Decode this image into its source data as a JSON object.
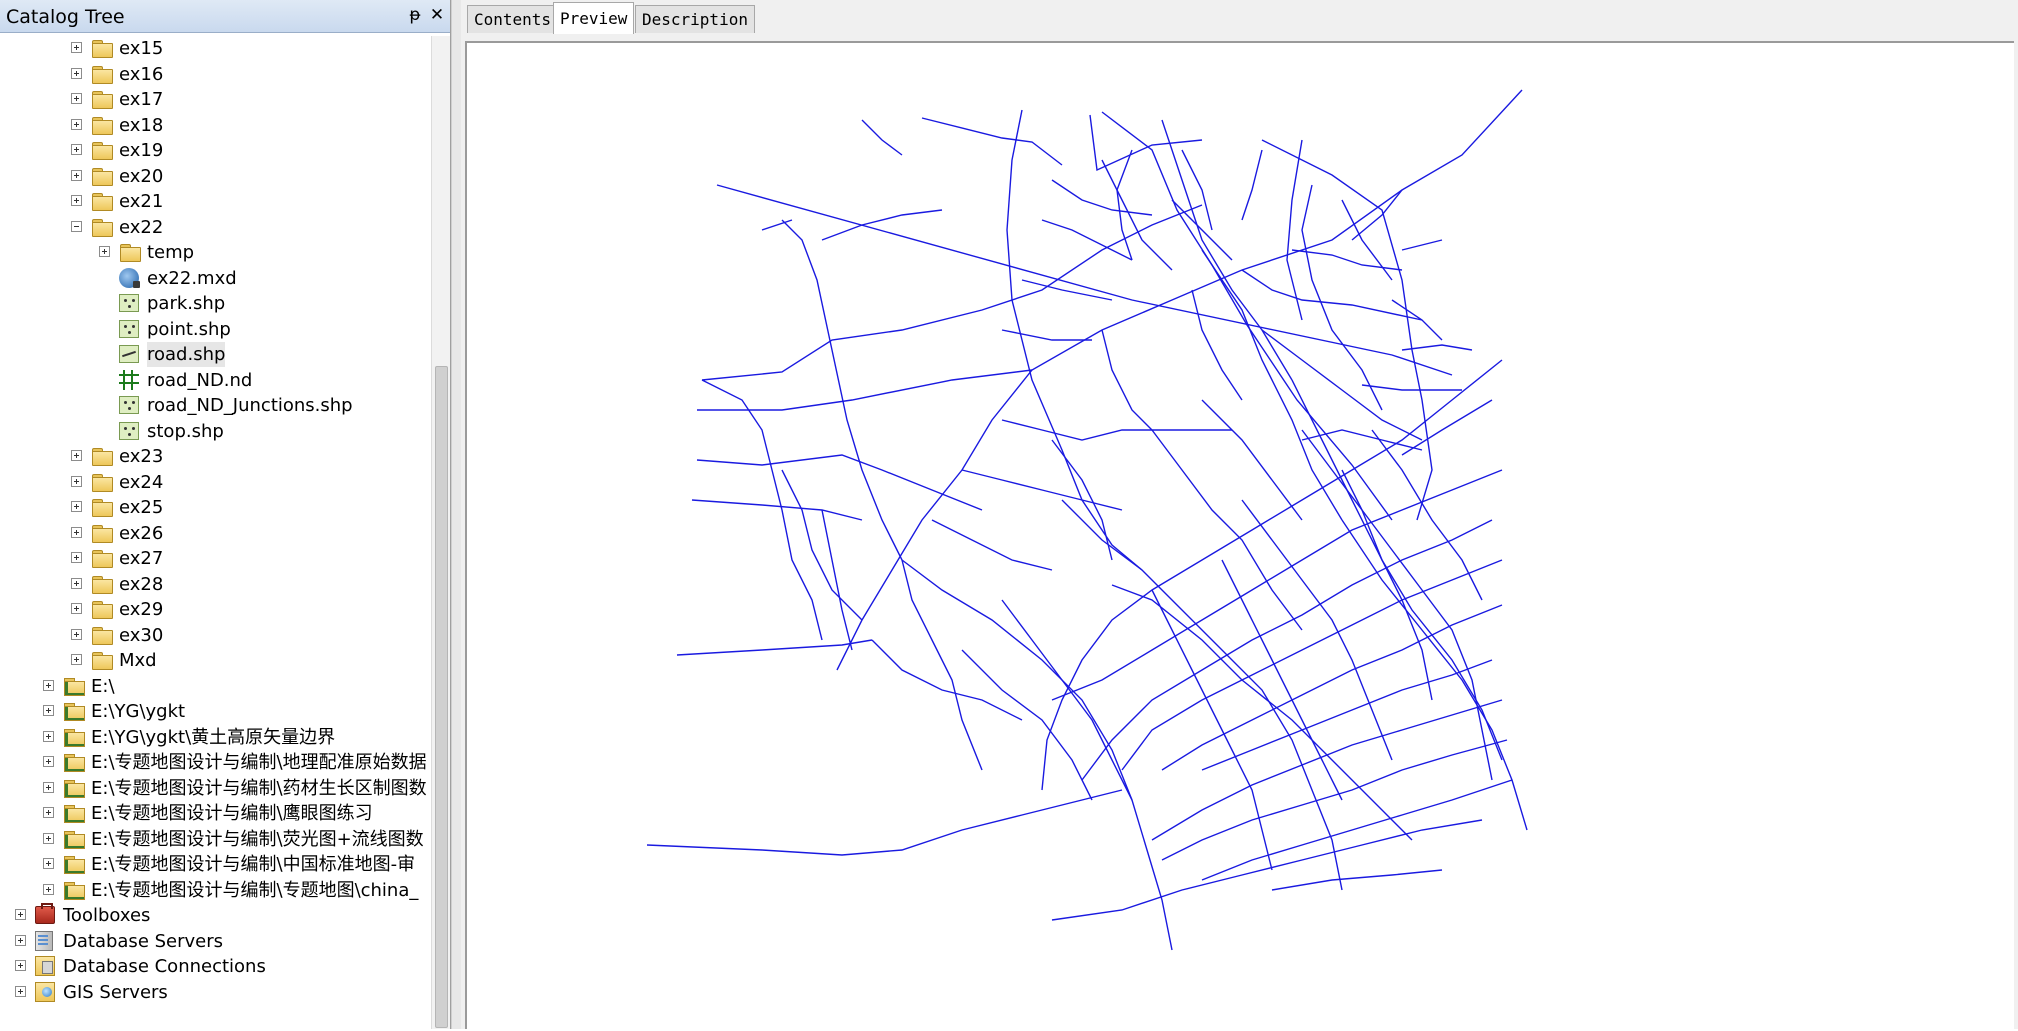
{
  "catalog": {
    "title": "Catalog Tree",
    "pin_glyph": "ᵽ",
    "close_glyph": "✕",
    "items": [
      {
        "label": "ex15",
        "icon": "folder-icon",
        "depth": 1,
        "toggle": "plus"
      },
      {
        "label": "ex16",
        "icon": "folder-icon",
        "depth": 1,
        "toggle": "plus"
      },
      {
        "label": "ex17",
        "icon": "folder-icon",
        "depth": 1,
        "toggle": "plus"
      },
      {
        "label": "ex18",
        "icon": "folder-icon",
        "depth": 1,
        "toggle": "plus"
      },
      {
        "label": "ex19",
        "icon": "folder-icon",
        "depth": 1,
        "toggle": "plus"
      },
      {
        "label": "ex20",
        "icon": "folder-icon",
        "depth": 1,
        "toggle": "plus"
      },
      {
        "label": "ex21",
        "icon": "folder-icon",
        "depth": 1,
        "toggle": "plus"
      },
      {
        "label": "ex22",
        "icon": "folder-icon",
        "depth": 1,
        "toggle": "minus"
      },
      {
        "label": "temp",
        "icon": "folder-icon",
        "depth": 2,
        "toggle": "plus"
      },
      {
        "label": "ex22.mxd",
        "icon": "map-document-icon",
        "depth": 2,
        "toggle": "none"
      },
      {
        "label": "park.shp",
        "icon": "point-shapefile-icon",
        "depth": 2,
        "toggle": "none"
      },
      {
        "label": "point.shp",
        "icon": "point-shapefile-icon",
        "depth": 2,
        "toggle": "none"
      },
      {
        "label": "road.shp",
        "icon": "line-shapefile-icon",
        "depth": 2,
        "toggle": "none",
        "selected": true
      },
      {
        "label": "road_ND.nd",
        "icon": "network-dataset-icon",
        "depth": 2,
        "toggle": "none"
      },
      {
        "label": "road_ND_Junctions.shp",
        "icon": "point-shapefile-icon",
        "depth": 2,
        "toggle": "none"
      },
      {
        "label": "stop.shp",
        "icon": "point-shapefile-icon",
        "depth": 2,
        "toggle": "none"
      },
      {
        "label": "ex23",
        "icon": "folder-icon",
        "depth": 1,
        "toggle": "plus"
      },
      {
        "label": "ex24",
        "icon": "folder-icon",
        "depth": 1,
        "toggle": "plus"
      },
      {
        "label": "ex25",
        "icon": "folder-icon",
        "depth": 1,
        "toggle": "plus"
      },
      {
        "label": "ex26",
        "icon": "folder-icon",
        "depth": 1,
        "toggle": "plus"
      },
      {
        "label": "ex27",
        "icon": "folder-icon",
        "depth": 1,
        "toggle": "plus"
      },
      {
        "label": "ex28",
        "icon": "folder-icon",
        "depth": 1,
        "toggle": "plus"
      },
      {
        "label": "ex29",
        "icon": "folder-icon",
        "depth": 1,
        "toggle": "plus"
      },
      {
        "label": "ex30",
        "icon": "folder-icon",
        "depth": 1,
        "toggle": "plus"
      },
      {
        "label": "Mxd",
        "icon": "folder-icon",
        "depth": 1,
        "toggle": "plus"
      },
      {
        "label": "E:\\",
        "icon": "folder-connection-icon",
        "depth": 0,
        "toggle": "plus"
      },
      {
        "label": "E:\\YG\\ygkt",
        "icon": "folder-connection-icon",
        "depth": 0,
        "toggle": "plus"
      },
      {
        "label": "E:\\YG\\ygkt\\黄土高原矢量边界",
        "icon": "folder-connection-icon",
        "depth": 0,
        "toggle": "plus"
      },
      {
        "label": "E:\\专题地图设计与编制\\地理配准原始数据",
        "icon": "folder-connection-icon",
        "depth": 0,
        "toggle": "plus"
      },
      {
        "label": "E:\\专题地图设计与编制\\药材生长区制图数",
        "icon": "folder-connection-icon",
        "depth": 0,
        "toggle": "plus"
      },
      {
        "label": "E:\\专题地图设计与编制\\鹰眼图练习",
        "icon": "folder-connection-icon",
        "depth": 0,
        "toggle": "plus"
      },
      {
        "label": "E:\\专题地图设计与编制\\荧光图+流线图数",
        "icon": "folder-connection-icon",
        "depth": 0,
        "toggle": "plus"
      },
      {
        "label": "E:\\专题地图设计与编制\\中国标准地图-审",
        "icon": "folder-connection-icon",
        "depth": 0,
        "toggle": "plus"
      },
      {
        "label": "E:\\专题地图设计与编制\\专题地图\\china_",
        "icon": "folder-connection-icon",
        "depth": 0,
        "toggle": "plus"
      },
      {
        "label": "Toolboxes",
        "icon": "toolbox-icon",
        "depth": -1,
        "toggle": "plus"
      },
      {
        "label": "Database Servers",
        "icon": "database-server-icon",
        "depth": -1,
        "toggle": "plus"
      },
      {
        "label": "Database Connections",
        "icon": "database-connection-icon",
        "depth": -1,
        "toggle": "plus"
      },
      {
        "label": "GIS Servers",
        "icon": "gis-server-icon",
        "depth": -1,
        "toggle": "plus"
      }
    ]
  },
  "tabs": [
    {
      "label": "Contents",
      "active": false
    },
    {
      "label": "Preview",
      "active": true
    },
    {
      "label": "Description",
      "active": false
    }
  ],
  "colors": {
    "road_line": "#1a1ae0",
    "title_bar": "#c9d9ee",
    "selection": "#e6e6e6"
  }
}
